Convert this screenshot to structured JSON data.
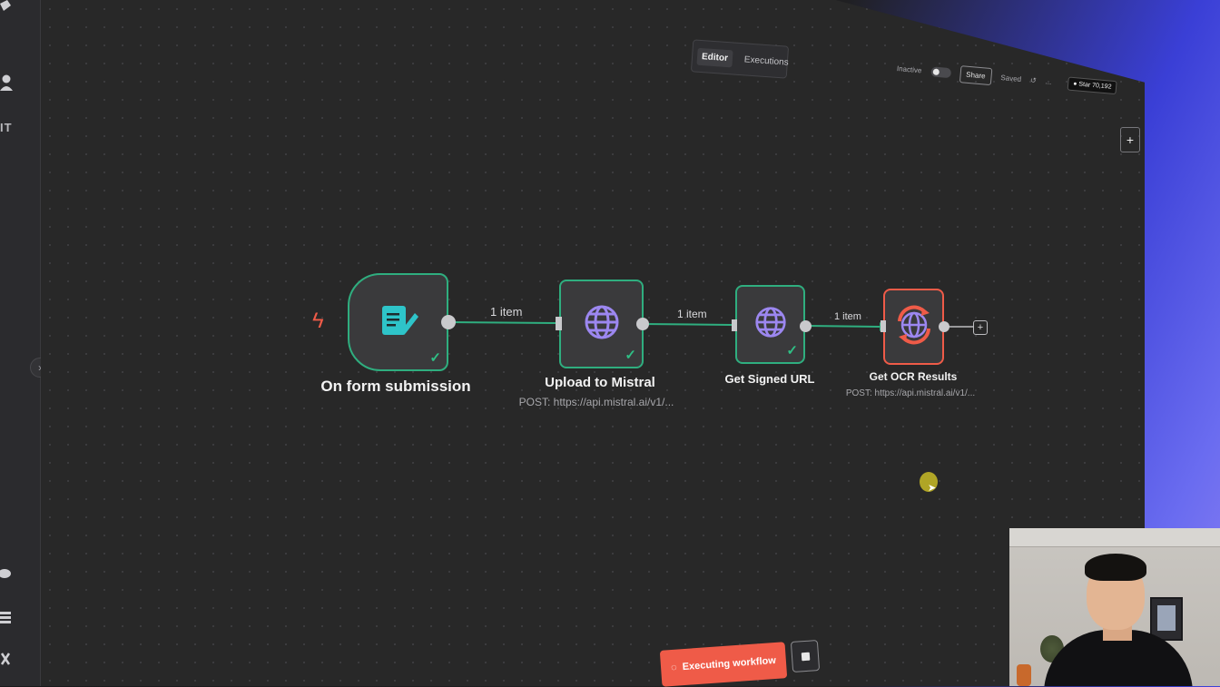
{
  "sidebar": {
    "item_text": "IT"
  },
  "header": {
    "tabs": [
      {
        "label": "Editor",
        "active": true
      },
      {
        "label": "Executions",
        "active": false
      }
    ],
    "status_label": "Inactive",
    "share_label": "Share",
    "saved_label": "Saved",
    "more_label": "...",
    "github_label": "Star",
    "github_count": "70,192"
  },
  "canvas_add_label": "+",
  "nodes": [
    {
      "title": "On form submission",
      "subtitle": "",
      "icon": "form-icon",
      "status": "success"
    },
    {
      "title": "Upload to Mistral",
      "subtitle": "POST: https://api.mistral.ai/v1/...",
      "icon": "globe-icon",
      "status": "success"
    },
    {
      "title": "Get Signed URL",
      "subtitle": "",
      "icon": "globe-icon",
      "status": "success"
    },
    {
      "title": "Get OCR Results",
      "subtitle": "POST: https://api.mistral.ai/v1/...",
      "icon": "globe-refresh-icon",
      "status": "running"
    }
  ],
  "connections": [
    {
      "label": "1 item"
    },
    {
      "label": "1 item"
    },
    {
      "label": "1 item"
    }
  ],
  "add_node_label": "+",
  "execute": {
    "label": "Executing workflow"
  },
  "colors": {
    "success": "#2fae7f",
    "error": "#ef5b48",
    "node_bg": "#3a3a3c",
    "canvas_bg": "#282828",
    "globe": "#9c87f0",
    "form": "#2ec4c9"
  }
}
